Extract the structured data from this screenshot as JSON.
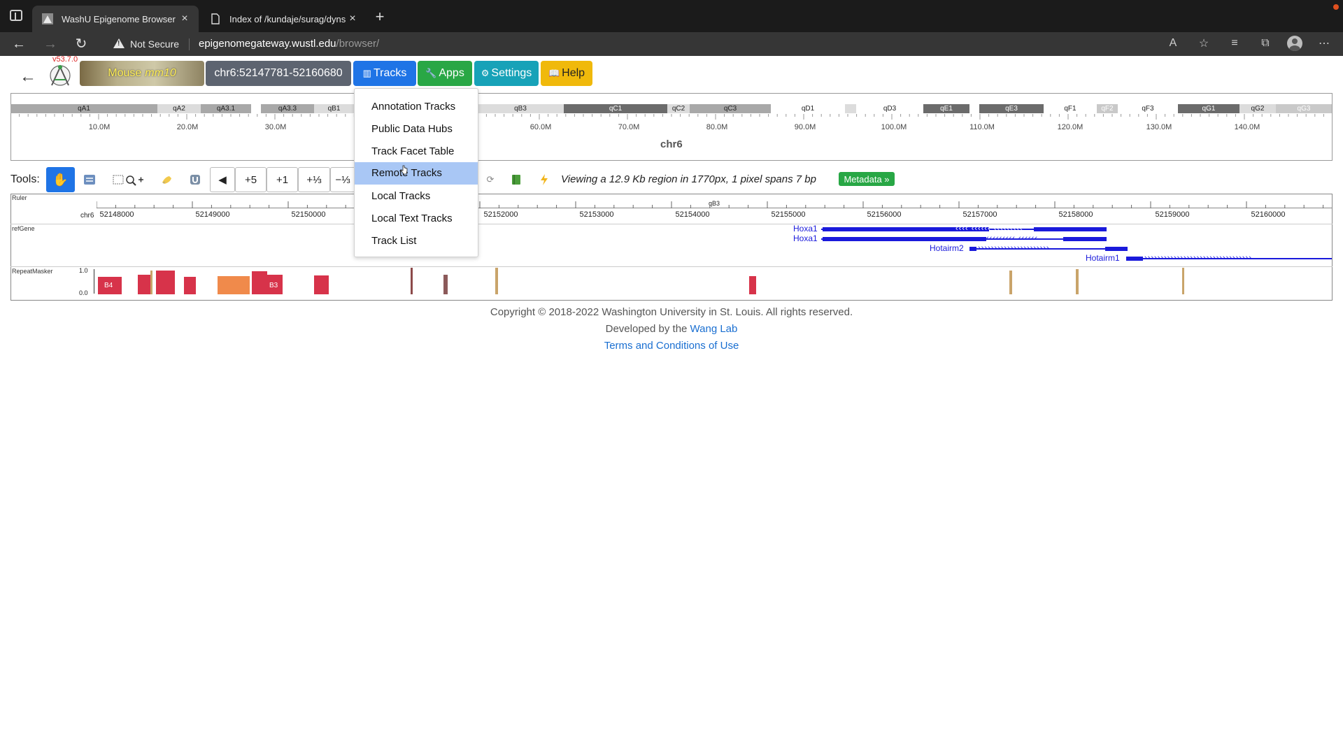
{
  "browser": {
    "tabs": [
      {
        "title": "WashU Epigenome Browser",
        "active": true
      },
      {
        "title": "Index of /kundaje/surag/dynse",
        "active": false
      }
    ],
    "security_label": "Not Secure",
    "url_host": "epigenomegateway.wustl.edu",
    "url_path": "/browser/"
  },
  "app": {
    "version": "v53.7.0",
    "genome_label": "Mouse",
    "genome_assembly": "mm10",
    "region": "chr6:52147781-52160680",
    "nav": {
      "tracks": "Tracks",
      "apps": "Apps",
      "settings": "Settings",
      "help": "Help"
    }
  },
  "ideogram": {
    "chromosome": "chr6",
    "bands": [
      "qA1",
      "qA2",
      "qA3.1",
      "qA3.3",
      "qB1",
      "qB3",
      "qC1",
      "qC2",
      "qC3",
      "qD1",
      "qD3",
      "qE1",
      "qE3",
      "qF1",
      "qF2",
      "qF3",
      "qG1",
      "qG2",
      "qG3"
    ],
    "tick_labels": [
      "10.0M",
      "20.0M",
      "30.0M",
      "60.0M",
      "70.0M",
      "80.0M",
      "90.0M",
      "100.0M",
      "110.0M",
      "120.0M",
      "130.0M",
      "140.0M"
    ]
  },
  "tools": {
    "label": "Tools:",
    "zoom_in_5": "+5",
    "zoom_in_1": "+1",
    "zoom_in_third": "+⅓",
    "zoom_out_third": "−⅓",
    "view_info": "Viewing a 12.9 Kb region in 1770px, 1 pixel spans 7 bp",
    "metadata": "Metadata »"
  },
  "tracks": {
    "ruler": {
      "label": "Ruler",
      "chr": "chr6",
      "band": "qB3",
      "labels": [
        "52148000",
        "52149000",
        "52150000",
        "52152000",
        "52153000",
        "52154000",
        "52155000",
        "52156000",
        "52157000",
        "52158000",
        "52159000",
        "52160000"
      ]
    },
    "refgene": {
      "label": "refGene",
      "genes": [
        "Hoxa1",
        "Hoxa1",
        "Hotairm2",
        "Hotairm1"
      ]
    },
    "repeatmasker": {
      "label": "RepeatMasker",
      "axis_max": "1.0",
      "axis_min": "0.0",
      "element_labels": [
        "B4",
        "B3"
      ]
    }
  },
  "dropdown": {
    "items": [
      "Annotation Tracks",
      "Public Data Hubs",
      "Track Facet Table",
      "Remote Tracks",
      "Local Tracks",
      "Local Text Tracks",
      "Track List"
    ],
    "highlighted": "Remote Tracks"
  },
  "footer": {
    "copyright": "Copyright © 2018-2022 Washington University in St. Louis. All rights reserved.",
    "developed_by": "Developed by the",
    "lab": "Wang Lab",
    "terms": "Terms and Conditions of Use"
  },
  "colors": {
    "tracks_button": "#1f74e6",
    "apps_button": "#29a745",
    "settings_button": "#17a2b8",
    "help_button": "#f0b90b",
    "gene": "#1a1adb",
    "repeat_red": "#d7334a",
    "repeat_orange": "#f08a4b",
    "repeat_tan": "#c9a46a"
  }
}
